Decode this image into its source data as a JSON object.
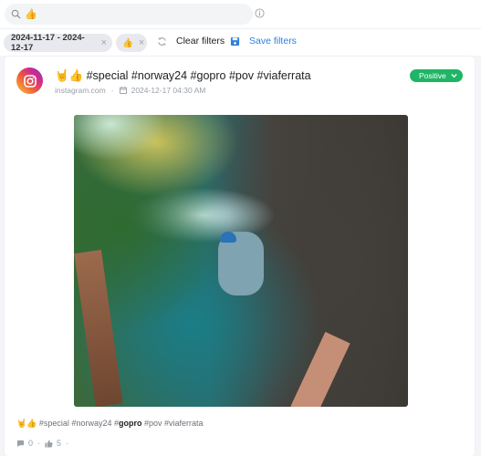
{
  "search": {
    "query": "👍",
    "query_icon": "thumbs-up-emoji"
  },
  "filters": {
    "chips": [
      {
        "label": "2024-11-17 - 2024-12-17",
        "remove": "×"
      },
      {
        "label": "👍",
        "remove": "×"
      }
    ],
    "clear_label": "Clear filters",
    "save_label": "Save filters"
  },
  "post": {
    "source_icon": "instagram-icon",
    "title": "🤘👍 #special #norway24 #gopro #pov #viaferrata",
    "source": "instagram.com",
    "separator": "·",
    "datetime": "2024-12-17 04:30 AM",
    "sentiment": {
      "label": "Positive",
      "color": "#1fb566"
    },
    "image_description": "Via ferrata climbers on a rock wall above a turquoise river and waterfall in Norway",
    "caption": {
      "prefix": "🤘👍 #special #norway24 #",
      "highlight": "gopro",
      "suffix": " #pov #viaferrata"
    },
    "stats": {
      "comments": "0",
      "likes": "5",
      "separator": "·"
    }
  },
  "colors": {
    "accent": "#2d7fdf",
    "positive": "#1fb566",
    "muted": "#9aa0a8"
  }
}
